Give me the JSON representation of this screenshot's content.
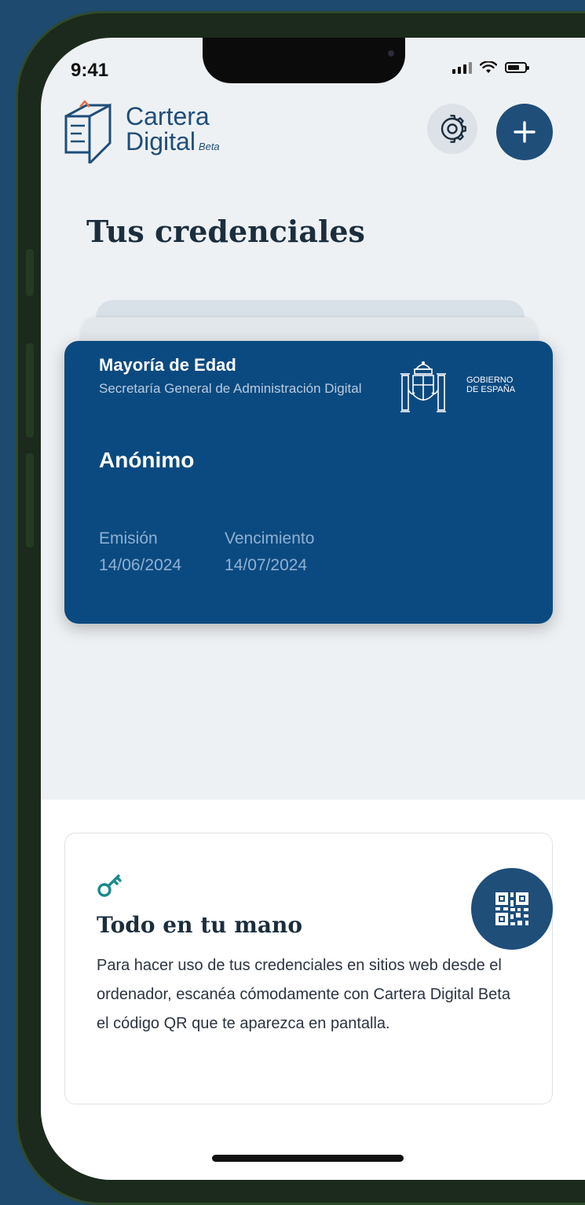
{
  "status_bar": {
    "time": "9:41"
  },
  "header": {
    "logo_line1": "Cartera",
    "logo_line2": "Digital",
    "logo_badge": "Beta"
  },
  "page_title": "Tus credenciales",
  "credential": {
    "type": "Mayoría de Edad",
    "issuer": "Secretaría General de Administración Digital",
    "gov_line1": "GOBIERNO",
    "gov_line2": "DE ESPAÑA",
    "holder": "Anónimo",
    "issue_label": "Emisión",
    "issue_date": "14/06/2024",
    "expiry_label": "Vencimiento",
    "expiry_date": "14/07/2024"
  },
  "info_card": {
    "title": "Todo en tu mano",
    "body": "Para hacer uso de tus credenciales en sitios web desde el ordenador, escanéa cómodamente con Cartera Digital Beta el código QR que te aparezca en pantalla."
  },
  "colors": {
    "background": "#1d4a6e",
    "primary": "#1f4e79",
    "card": "#0b4a80",
    "key_icon": "#1a8a8a"
  },
  "icons": [
    "wallet-logo-icon",
    "gear-icon",
    "plus-icon",
    "spain-coat-of-arms-icon",
    "key-icon",
    "qr-code-icon",
    "signal-icon",
    "wifi-icon",
    "battery-icon"
  ]
}
